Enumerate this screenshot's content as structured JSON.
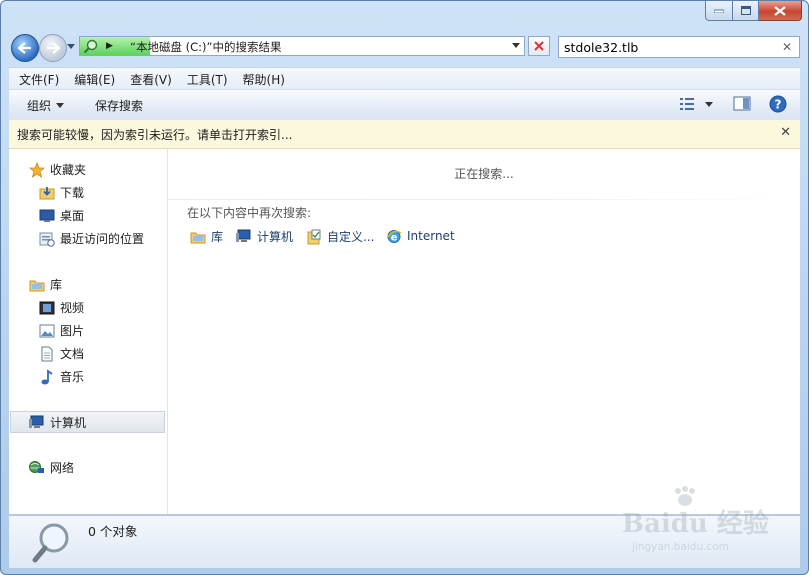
{
  "address": {
    "path": "“本地磁盘 (C:)”中的搜索结果"
  },
  "search": {
    "value": "stdole32.tlb"
  },
  "menu": [
    {
      "label": "文件(F)"
    },
    {
      "label": "编辑(E)"
    },
    {
      "label": "查看(V)"
    },
    {
      "label": "工具(T)"
    },
    {
      "label": "帮助(H)"
    }
  ],
  "toolbar": {
    "organize_label": "组织",
    "save_search_label": "保存搜索"
  },
  "infobar": {
    "message": "搜索可能较慢，因为索引未运行。请单击打开索引..."
  },
  "nav": {
    "favorites": "收藏夹",
    "downloads": "下载",
    "desktop": "桌面",
    "recent": "最近访问的位置",
    "libraries": "库",
    "videos": "视频",
    "pictures": "图片",
    "documents": "文档",
    "music": "音乐",
    "computer": "计算机",
    "network": "网络"
  },
  "main": {
    "searching": "正在搜索...",
    "search_again_label": "在以下内容中再次搜索:",
    "search_again": [
      {
        "label": "库"
      },
      {
        "label": "计算机"
      },
      {
        "label": "自定义..."
      },
      {
        "label": "Internet"
      }
    ]
  },
  "status": {
    "count": "0 个对象"
  },
  "watermark": {
    "logo": "Baidu 经验",
    "url": "jingyan.baidu.com"
  },
  "colors": {
    "frame": "#b9d3ee",
    "infobar": "#fbf8dd",
    "progress": "#5bd35a",
    "close": "#c8452f"
  }
}
